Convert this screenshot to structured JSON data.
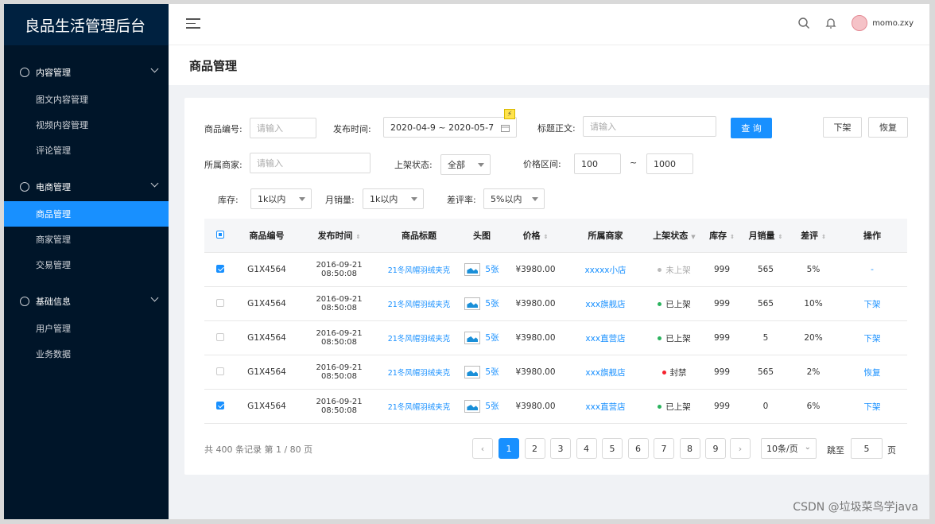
{
  "app": {
    "title": "良品生活管理后台"
  },
  "sidebar": {
    "groups": [
      {
        "label": "内容管理",
        "items": [
          "图文内容管理",
          "视频内容管理",
          "评论管理"
        ]
      },
      {
        "label": "电商管理",
        "items": [
          "商品管理",
          "商家管理",
          "交易管理"
        ]
      },
      {
        "label": "基础信息",
        "items": [
          "用户管理",
          "业务数据"
        ]
      }
    ],
    "active": "商品管理"
  },
  "header": {
    "username": "momo.zxy"
  },
  "page": {
    "title": "商品管理"
  },
  "filters": {
    "code_label": "商品编号:",
    "code_placeholder": "请输入",
    "date_label": "发布时间:",
    "date_value": "2020-04-9 ~ 2020-05-7",
    "title_label": "标题正文:",
    "title_placeholder": "请输入",
    "query_btn": "查 询",
    "off_btn": "下架",
    "restore_btn": "恢复",
    "merchant_label": "所属商家:",
    "merchant_placeholder": "请输入",
    "status_label": "上架状态:",
    "status_value": "全部",
    "price_label": "价格区间:",
    "price_min": "100",
    "price_sep": "~",
    "price_max": "1000",
    "stock_label": "库存:",
    "stock_value": "1k以内",
    "sales_label": "月销量:",
    "sales_value": "1k以内",
    "bad_label": "差评率:",
    "bad_value": "5%以内"
  },
  "table": {
    "headers": [
      "商品编号",
      "发布时间",
      "商品标题",
      "头图",
      "价格",
      "所属商家",
      "上架状态",
      "库存",
      "月销量",
      "差评",
      "操作"
    ],
    "rows": [
      {
        "checked": true,
        "code": "G1X4564",
        "time": "2016-09-21  08:50:08",
        "title": "21冬风帽羽绒夹克",
        "pics": "5张",
        "price": "¥3980.00",
        "shop": "xxxxx小店",
        "status": "未上架",
        "status_color": "#bbbbbb",
        "stock": "999",
        "sales": "565",
        "bad": "5%",
        "op": "-"
      },
      {
        "checked": false,
        "code": "G1X4564",
        "time": "2016-09-21  08:50:08",
        "title": "21冬风帽羽绒夹克",
        "pics": "5张",
        "price": "¥3980.00",
        "shop": "xxx旗舰店",
        "status": "已上架",
        "status_color": "#2bb35e",
        "stock": "999",
        "sales": "565",
        "bad": "10%",
        "op": "下架"
      },
      {
        "checked": false,
        "code": "G1X4564",
        "time": "2016-09-21  08:50:08",
        "title": "21冬风帽羽绒夹克",
        "pics": "5张",
        "price": "¥3980.00",
        "shop": "xxx直营店",
        "status": "已上架",
        "status_color": "#2bb35e",
        "stock": "999",
        "sales": "5",
        "bad": "20%",
        "op": "下架"
      },
      {
        "checked": false,
        "code": "G1X4564",
        "time": "2016-09-21  08:50:08",
        "title": "21冬风帽羽绒夹克",
        "pics": "5张",
        "price": "¥3980.00",
        "shop": "xxx旗舰店",
        "status": "封禁",
        "status_color": "#f5222d",
        "stock": "999",
        "sales": "565",
        "bad": "2%",
        "op": "恢复"
      },
      {
        "checked": true,
        "code": "G1X4564",
        "time": "2016-09-21  08:50:08",
        "title": "21冬风帽羽绒夹克",
        "pics": "5张",
        "price": "¥3980.00",
        "shop": "xxx直营店",
        "status": "已上架",
        "status_color": "#2bb35e",
        "stock": "999",
        "sales": "0",
        "bad": "6%",
        "op": "下架"
      }
    ]
  },
  "pagination": {
    "summary": "共 400 条记录 第 1 / 80 页",
    "pages": [
      "1",
      "2",
      "3",
      "4",
      "5",
      "6",
      "7",
      "8",
      "9"
    ],
    "current": "1",
    "page_size": "10条/页",
    "jump_label": "跳至",
    "jump_value": "5",
    "page_unit": "页"
  },
  "watermark": "CSDN @垃圾菜鸟学java",
  "colors": {
    "accent": "#1890ff",
    "sidebar": "#001529"
  }
}
